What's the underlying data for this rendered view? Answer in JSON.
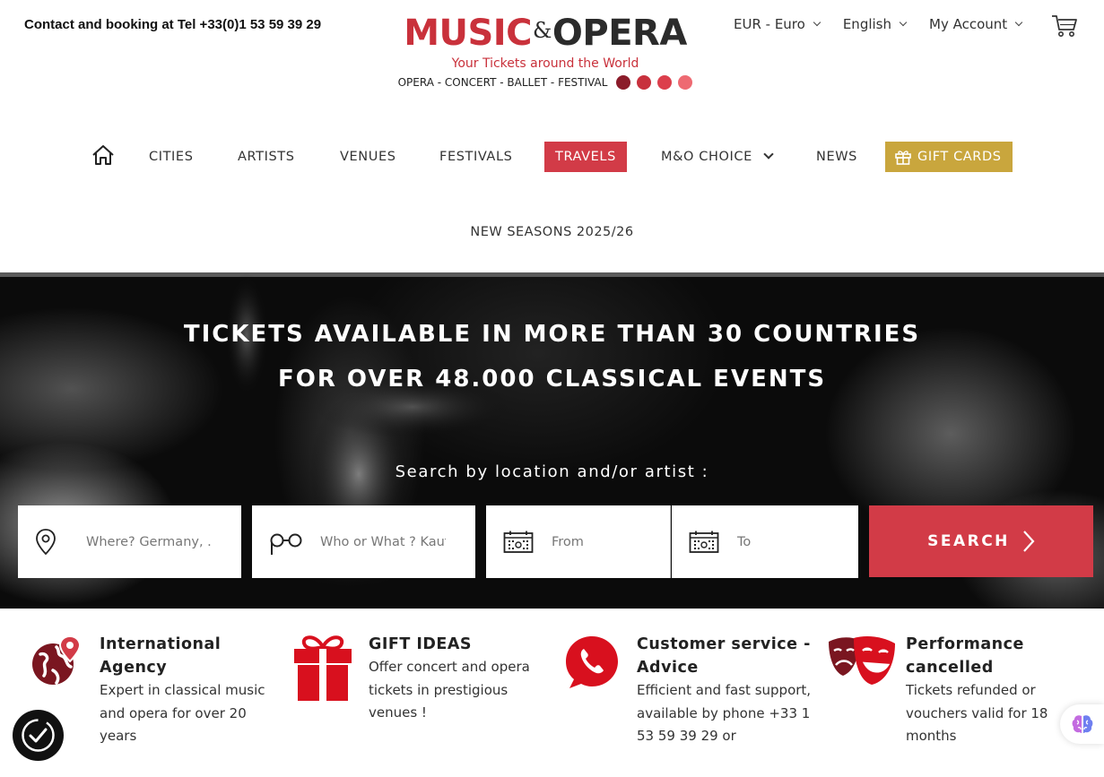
{
  "header": {
    "contact": "Contact and booking at Tel +33(0)1 53 59 39 29",
    "logo": {
      "music": "MUSIC",
      "amp": "&",
      "opera": "OPERA",
      "tagline": "Your Tickets around the World",
      "genres": "OPERA - CONCERT - BALLET - FESTIVAL",
      "dot_colors": [
        "#8b1c2a",
        "#c8313d",
        "#dc3f4c",
        "#ee6a72"
      ]
    },
    "currency": "EUR - Euro",
    "language": "English",
    "account": "My Account",
    "cart_icon": "cart-icon"
  },
  "nav": {
    "home_icon": "home-icon",
    "items": [
      "CITIES",
      "ARTISTS",
      "VENUES",
      "FESTIVALS",
      "TRAVELS",
      "M&O CHOICE",
      "NEWS",
      "GIFT CARDS"
    ],
    "new_seasons": "NEW SEASONS 2025/26"
  },
  "hero": {
    "line1": "TICKETS AVAILABLE IN MORE THAN 30 COUNTRIES",
    "line2": "FOR OVER 48.000 CLASSICAL EVENTS",
    "search_label": "Search by location and/or artist :",
    "where_placeholder": "Where? Germany, ...",
    "who_placeholder": "Who or What ? Kaufmann...",
    "from_placeholder": "From",
    "to_placeholder": "To",
    "search_button": "SEARCH"
  },
  "features": [
    {
      "icon": "globe-pin-icon",
      "title": "International Agency",
      "text": "Expert in classical music and opera for over 20 years"
    },
    {
      "icon": "gift-icon",
      "title": "GIFT IDEAS",
      "text": "Offer concert and opera tickets in prestigious venues !"
    },
    {
      "icon": "phone-icon",
      "title": "Customer service - Advice",
      "text": "Efficient and fast support, available by phone +33 1 53 59 39 29 or"
    },
    {
      "icon": "theater-masks-icon",
      "title": "Performance cancelled",
      "text": "Tickets refunded or vouchers valid for 18 months"
    }
  ],
  "colors": {
    "brand_red": "#d23b47",
    "gift_gold": "#c9a63d",
    "text_dark": "#222222"
  }
}
